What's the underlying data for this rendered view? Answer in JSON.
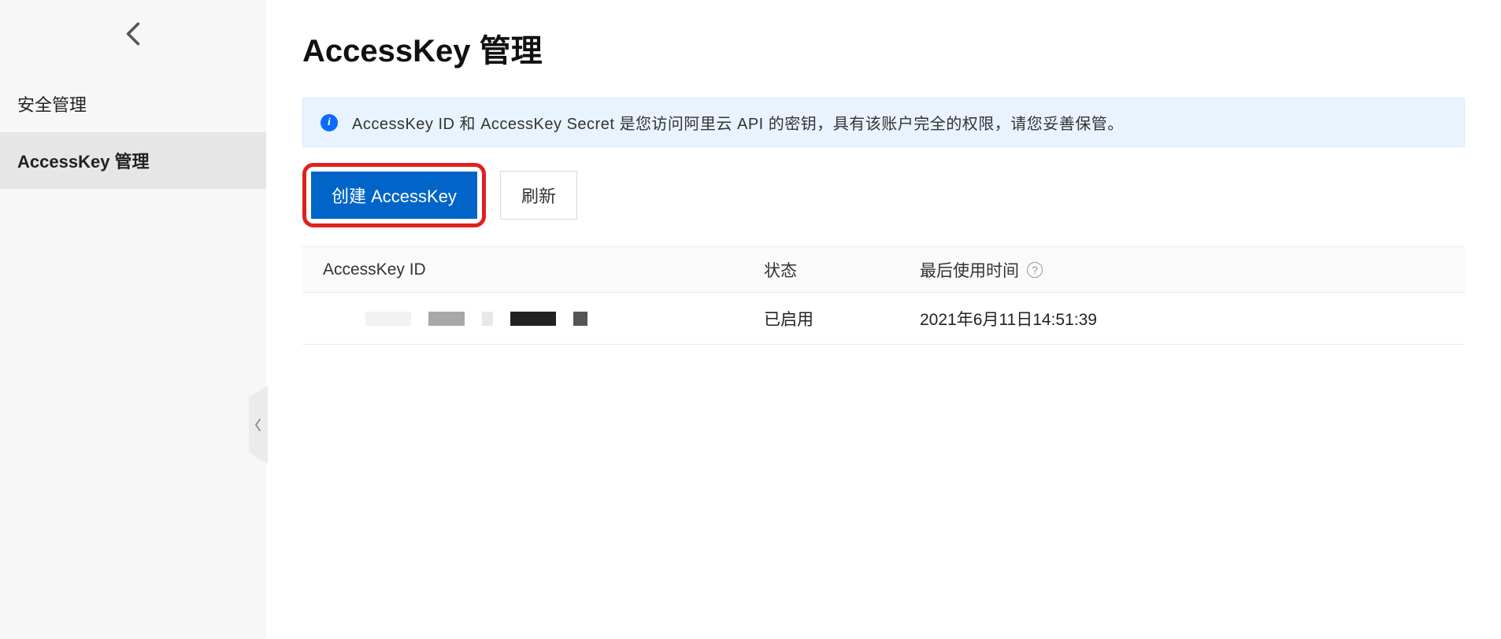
{
  "sidebar": {
    "items": [
      {
        "label": "安全管理"
      },
      {
        "label": "AccessKey 管理"
      }
    ]
  },
  "page": {
    "title": "AccessKey 管理"
  },
  "banner": {
    "text": "AccessKey ID 和 AccessKey Secret 是您访问阿里云 API 的密钥，具有该账户完全的权限，请您妥善保管。"
  },
  "actions": {
    "create_label": "创建 AccessKey",
    "refresh_label": "刷新"
  },
  "table": {
    "headers": {
      "id": "AccessKey ID",
      "status": "状态",
      "last_used": "最后使用时间"
    },
    "rows": [
      {
        "id_redacted": true,
        "status": "已启用",
        "last_used": "2021年6月11日14:51:39"
      }
    ]
  }
}
